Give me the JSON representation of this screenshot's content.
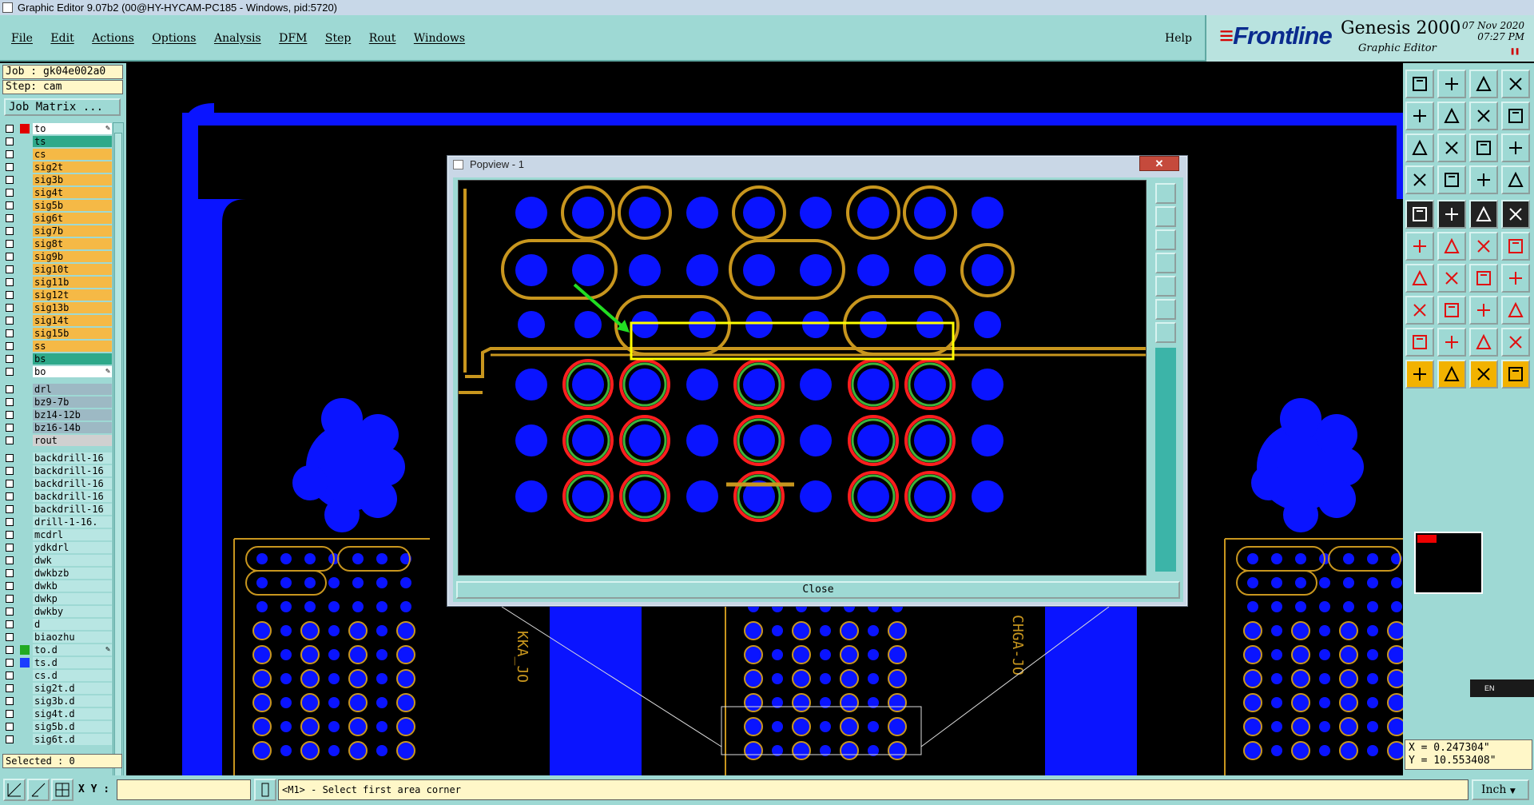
{
  "window": {
    "title": "Graphic Editor 9.07b2 (00@HY-HYCAM-PC185 - Windows, pid:5720)"
  },
  "menu": {
    "items": [
      "File",
      "Edit",
      "Actions",
      "Options",
      "Analysis",
      "DFM",
      "Step",
      "Rout",
      "Windows"
    ],
    "help": "Help"
  },
  "brand": {
    "frontline": "Frontline",
    "product": "Genesis 2000",
    "subtitle": "Graphic Editor",
    "date": "07 Nov 2020",
    "time": "07:27 PM"
  },
  "job": {
    "job_line": "Job : gk04e002a0",
    "step_line": "Step: cam",
    "matrix_button": "Job Matrix ..."
  },
  "layers": [
    {
      "name": "to",
      "color": "#ffffff",
      "swatch": "#e00000",
      "tag": "✎"
    },
    {
      "name": "ts",
      "color": "#2ea98a",
      "swatch": ""
    },
    {
      "name": "cs",
      "color": "#f5b946",
      "swatch": ""
    },
    {
      "name": "sig2t",
      "color": "#f5b946",
      "swatch": ""
    },
    {
      "name": "sig3b",
      "color": "#f5b946",
      "swatch": ""
    },
    {
      "name": "sig4t",
      "color": "#f5b946",
      "swatch": ""
    },
    {
      "name": "sig5b",
      "color": "#f5b946",
      "swatch": ""
    },
    {
      "name": "sig6t",
      "color": "#f5b946",
      "swatch": ""
    },
    {
      "name": "sig7b",
      "color": "#f5b946",
      "swatch": ""
    },
    {
      "name": "sig8t",
      "color": "#f5b946",
      "swatch": ""
    },
    {
      "name": "sig9b",
      "color": "#f5b946",
      "swatch": ""
    },
    {
      "name": "sig10t",
      "color": "#f5b946",
      "swatch": ""
    },
    {
      "name": "sig11b",
      "color": "#f5b946",
      "swatch": ""
    },
    {
      "name": "sig12t",
      "color": "#f5b946",
      "swatch": ""
    },
    {
      "name": "sig13b",
      "color": "#f5b946",
      "swatch": ""
    },
    {
      "name": "sig14t",
      "color": "#f5b946",
      "swatch": ""
    },
    {
      "name": "sig15b",
      "color": "#f5b946",
      "swatch": ""
    },
    {
      "name": "ss",
      "color": "#f5b946",
      "swatch": ""
    },
    {
      "name": "bs",
      "color": "#2ea98a",
      "swatch": ""
    },
    {
      "name": "bo",
      "color": "#ffffff",
      "swatch": "",
      "tag": "✎"
    }
  ],
  "drill_layers": [
    {
      "name": "drl",
      "color": "#9db9c4"
    },
    {
      "name": "bz9-7b",
      "color": "#9db9c4"
    },
    {
      "name": "bz14-12b",
      "color": "#9db9c4"
    },
    {
      "name": "bz16-14b",
      "color": "#9db9c4"
    },
    {
      "name": "rout",
      "color": "#d0d0d0"
    }
  ],
  "other_layers": [
    {
      "name": "backdrill-16",
      "color": "#b8e6e3"
    },
    {
      "name": "backdrill-16",
      "color": "#b8e6e3"
    },
    {
      "name": "backdrill-16",
      "color": "#b8e6e3"
    },
    {
      "name": "backdrill-16",
      "color": "#b8e6e3"
    },
    {
      "name": "backdrill-16",
      "color": "#b8e6e3"
    },
    {
      "name": "drill-1-16.",
      "color": "#b8e6e3"
    },
    {
      "name": "mcdrl",
      "color": "#b8e6e3"
    },
    {
      "name": "ydkdrl",
      "color": "#b8e6e3"
    },
    {
      "name": "dwk",
      "color": "#b8e6e3"
    },
    {
      "name": "dwkbzb",
      "color": "#b8e6e3"
    },
    {
      "name": "dwkb",
      "color": "#b8e6e3"
    },
    {
      "name": "dwkp",
      "color": "#b8e6e3"
    },
    {
      "name": "dwkby",
      "color": "#b8e6e3"
    },
    {
      "name": "d",
      "color": "#b8e6e3"
    },
    {
      "name": "biaozhu",
      "color": "#b8e6e3"
    },
    {
      "name": "to.d",
      "color": "#b8e6e3",
      "swatch": "#22aa22",
      "tag": "✎"
    },
    {
      "name": "ts.d",
      "color": "#b8e6e3",
      "swatch": "#1b3cff"
    },
    {
      "name": "cs.d",
      "color": "#b8e6e3"
    },
    {
      "name": "sig2t.d",
      "color": "#b8e6e3"
    },
    {
      "name": "sig3b.d",
      "color": "#b8e6e3"
    },
    {
      "name": "sig4t.d",
      "color": "#b8e6e3"
    },
    {
      "name": "sig5b.d",
      "color": "#b8e6e3"
    },
    {
      "name": "sig6t.d",
      "color": "#b8e6e3"
    }
  ],
  "status": {
    "selected": "Selected : 0"
  },
  "coords": {
    "x": "X = 0.247304\"",
    "y": "Y = 10.553408\""
  },
  "lang": "EN",
  "bottom": {
    "xy_label": "X Y :",
    "xy_value": "",
    "prompt": "<M1> - Select first area corner",
    "units": "Inch"
  },
  "popview": {
    "title": "Popview - 1",
    "close_x": "✕",
    "close_button": "Close"
  },
  "canvas_labels": {
    "left_text": "KKA_JO",
    "right_text": "CHGA-JO",
    "jo": "jo"
  },
  "colors": {
    "pad": "#0a14ff",
    "trace": "#c8961e",
    "ring_red": "#ff1e1e",
    "ring_green": "#3cb43c",
    "highlight": "#ffff00",
    "arrow": "#22dd22"
  }
}
